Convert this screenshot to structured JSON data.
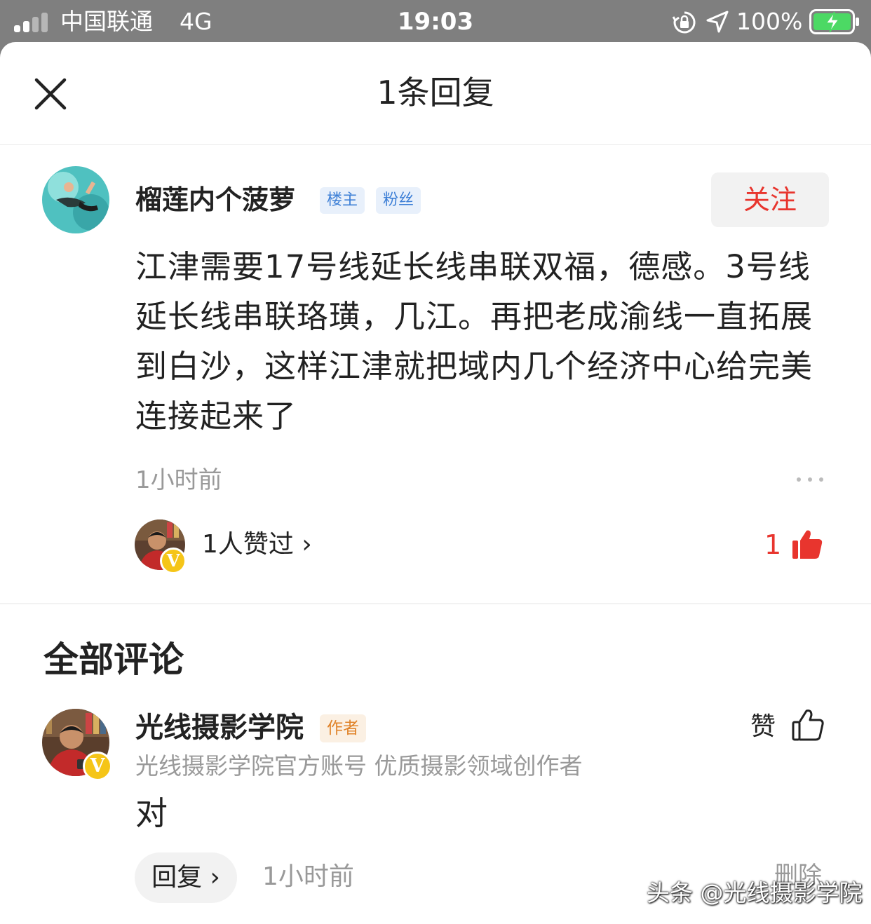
{
  "status_bar": {
    "carrier": "中国联通",
    "network": "4G",
    "time": "19:03",
    "battery": "100%",
    "icons": [
      "signal-icon",
      "rotation-lock-icon",
      "location-icon",
      "battery-charging-icon"
    ]
  },
  "header": {
    "title": "1条回复",
    "close_icon": "close-icon"
  },
  "main_comment": {
    "author": "榴莲内个菠萝",
    "tags": [
      "楼主",
      "粉丝"
    ],
    "follow_label": "关注",
    "text": "江津需要17号线延长线串联双福，德感。3号线延长线串联珞璜，几江。再把老成渝线一直拓展到白沙，这样江津就把域内几个经济中心给完美连接起来了",
    "time": "1小时前",
    "likers_text": "1人赞过 ›",
    "like_count": "1",
    "verified_badge": "V"
  },
  "comments_section": {
    "title": "全部评论",
    "items": [
      {
        "author": "光线摄影学院",
        "tag": "作者",
        "description": "光线摄影学院官方账号 优质摄影领域创作者",
        "text": "对",
        "reply_label": "回复 ›",
        "time": "1小时前",
        "like_label": "赞",
        "delete_label": "删除",
        "verified_badge": "V"
      }
    ]
  },
  "watermark": "头条 @光线摄影学院",
  "colors": {
    "accent_red": "#e8352e",
    "tag_blue": "#3d7fd6",
    "tag_orange": "#e0832a",
    "muted_text": "#999999",
    "status_bar_bg": "#7f7f7f"
  }
}
